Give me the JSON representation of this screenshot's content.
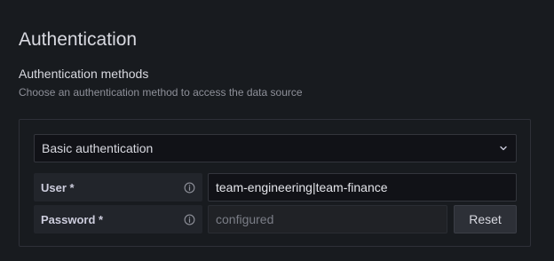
{
  "section": {
    "title": "Authentication"
  },
  "methods": {
    "title": "Authentication methods",
    "description": "Choose an authentication method to access the data source",
    "selected": "Basic authentication"
  },
  "fields": {
    "user": {
      "label": "User *",
      "value": "team-engineering|team-finance"
    },
    "password": {
      "label": "Password *",
      "placeholder": "configured",
      "reset_label": "Reset"
    }
  },
  "icons": {
    "chevron": "chevron-down-icon",
    "info": "info-circle-icon"
  },
  "colors": {
    "background": "#181b1f",
    "input_background": "#111217",
    "label_background": "#22252b",
    "button_background": "#2d3037"
  }
}
